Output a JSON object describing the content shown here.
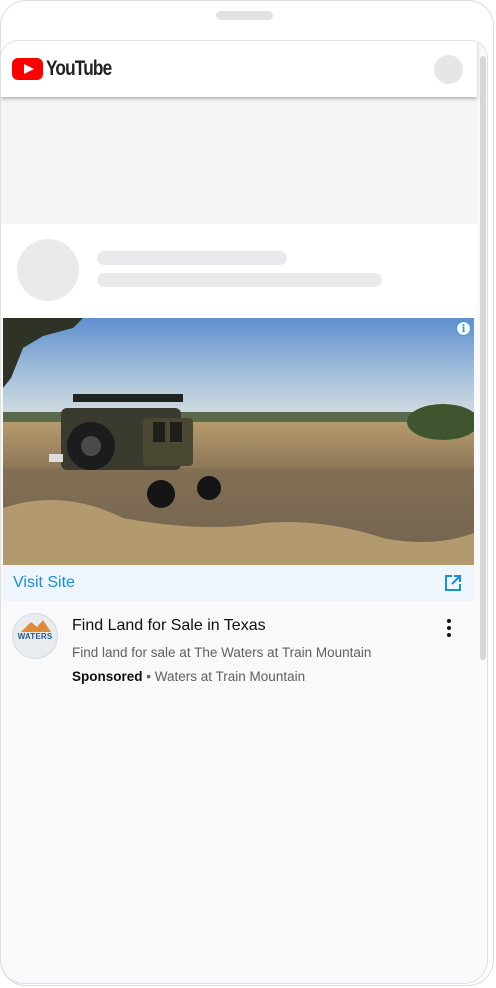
{
  "header": {
    "logo_text": "YouTube",
    "logo_icon": "youtube-play-icon",
    "account_icon": "avatar-placeholder"
  },
  "ad": {
    "visit_label": "Visit Site",
    "visit_icon": "external-link-icon",
    "info_icon": "info-icon",
    "title": "Find Land for Sale in Texas",
    "description": "Find land for sale at The Waters at Train Mountain",
    "sponsored_label": "Sponsored",
    "separator": "•",
    "advertiser": "Waters at Train Mountain",
    "advertiser_logo_text": "WATERS",
    "more_icon": "more-vert-icon"
  },
  "colors": {
    "brand_red": "#ff0000",
    "link_blue": "#1a8fd9",
    "visit_bar_bg": "#eef5fc"
  }
}
